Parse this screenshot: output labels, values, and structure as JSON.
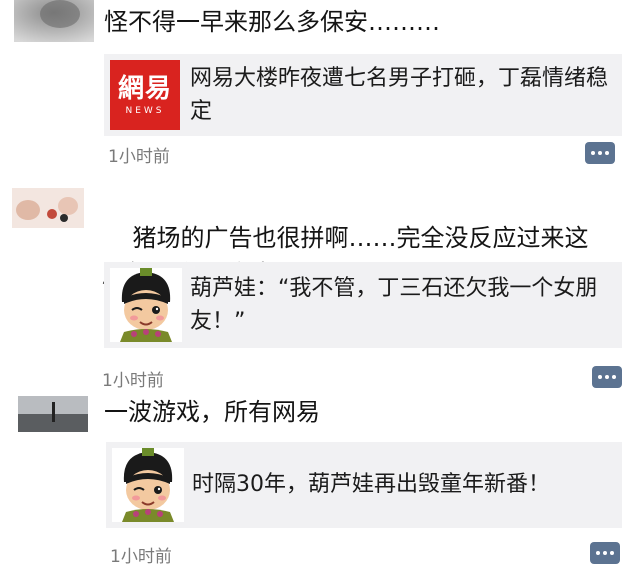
{
  "posts": [
    {
      "text": "怪不得一早来那么多保安………",
      "card_title": "网易大楼昨夜遭七名男子打砸，丁磊情绪稳定",
      "card_logo_main": "網易",
      "card_logo_sub": "NEWS",
      "time": "1小时前"
    },
    {
      "text": "猪场的广告也很拼啊……完全没反应过来这居然是个xx广告",
      "emoji": "😂",
      "card_title": "葫芦娃：“我不管，丁三石还欠我一个女朋友！”",
      "time": "1小时前"
    },
    {
      "text": "一波游戏，所有网易",
      "card_title": "时隔30年，葫芦娃再出毁童年新番！",
      "time": "1小时前"
    }
  ],
  "colors": {
    "card_bg": "#f1f1f3",
    "comment_button": "#5c7391",
    "netease_red": "#d9231f",
    "time_text": "#7a7a7a"
  },
  "icons": {
    "comment": "comment-dots-icon"
  }
}
